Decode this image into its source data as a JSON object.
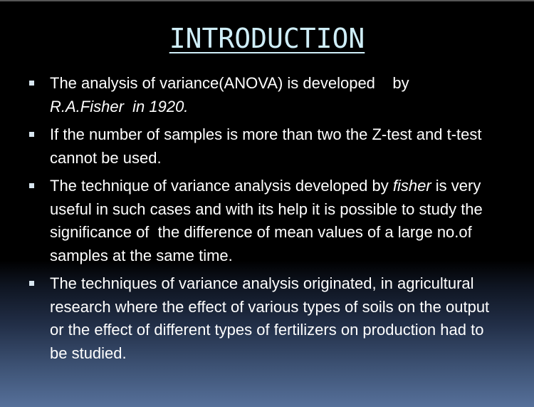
{
  "slide": {
    "title": "INTRODUCTION",
    "bullets": [
      {
        "line1": "The analysis of variance(ANOVA) is developed    by",
        "line2_italic": "R.A.Fisher  in 1920."
      },
      {
        "text": "If the number of samples is more than two the Z-test and t-test cannot be used."
      },
      {
        "before": "The technique of variance analysis developed by ",
        "italic": "fisher",
        "after": " is very useful in such cases and with its help it is possible to study the significance of  the difference of mean values of a large no.of  samples at the same time."
      },
      {
        "text": "The techniques of variance analysis originated, in agricultural research where the effect of various types of soils on the output or the effect of different types of fertilizers on production had to be studied."
      }
    ]
  },
  "colors": {
    "title": "#cfeef8",
    "text": "#ffffff",
    "background_top": "#000000",
    "background_bottom": "#56709a"
  }
}
